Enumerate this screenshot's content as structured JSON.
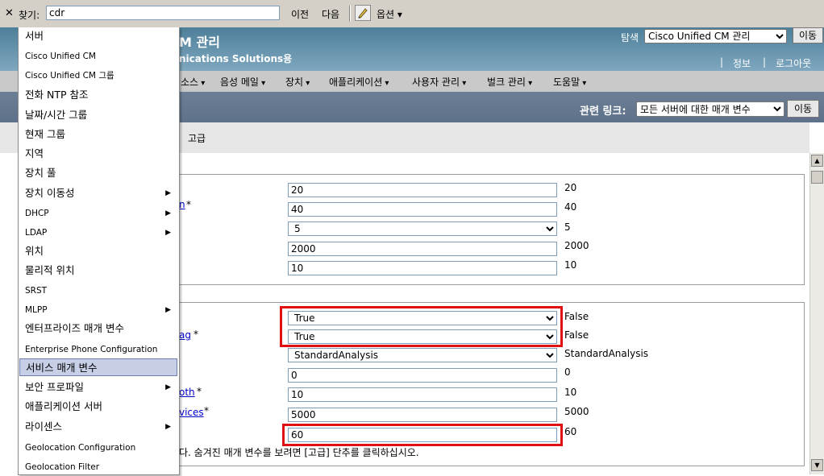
{
  "findbar": {
    "close_glyph": "✕",
    "label": "찾기:",
    "query": "cdr",
    "prev": "이전",
    "next": "다음",
    "options": "옵션"
  },
  "header": {
    "title": "M 관리",
    "subtitle": "nications Solutions용",
    "nav_label": "탐색",
    "nav_value": "Cisco Unified CM 관리",
    "go": "이동",
    "links": [
      "정보",
      "로그아웃"
    ]
  },
  "menubar": [
    "소스",
    "음성 메일",
    "장치",
    "애플리케이션",
    "사용자 관리",
    "벌크 관리",
    "도움말"
  ],
  "related": {
    "label": "관련 링크:",
    "value": "모든 서버에 대한 매개 변수",
    "go": "이동"
  },
  "toolbar": {
    "advanced": "고급"
  },
  "section1": {
    "rows": [
      {
        "value": "20",
        "default": "20",
        "type": "input"
      },
      {
        "label": "n",
        "required": true,
        "value": "40",
        "default": "40",
        "type": "input"
      },
      {
        "value": "5",
        "default": "5",
        "type": "select"
      },
      {
        "value": "2000",
        "default": "2000",
        "type": "input"
      },
      {
        "value": "10",
        "default": "10",
        "type": "input"
      }
    ]
  },
  "section2": {
    "rows": [
      {
        "value": "True",
        "default": "False",
        "type": "select"
      },
      {
        "label": "ag",
        "required": true,
        "value": "True",
        "default": "False",
        "type": "select"
      },
      {
        "value": "StandardAnalysis",
        "default": "StandardAnalysis",
        "type": "select"
      },
      {
        "value": "0",
        "default": "0",
        "type": "input"
      },
      {
        "label": "oth",
        "required": true,
        "value": "10",
        "default": "10",
        "type": "input"
      },
      {
        "label": "vices",
        "required": true,
        "value": "5000",
        "default": "5000",
        "type": "input"
      },
      {
        "value": "60",
        "default": "60",
        "type": "input"
      }
    ]
  },
  "footnote": "다. 숨겨진 매개 변수를 보려면 [고급] 단추를 클릭하십시오.",
  "dropdown": [
    {
      "label": "서버"
    },
    {
      "label": "Cisco Unified CM"
    },
    {
      "label": "Cisco Unified CM 그룹"
    },
    {
      "label": "전화 NTP 참조"
    },
    {
      "label": "날짜/시간 그룹"
    },
    {
      "label": "현재 그룹"
    },
    {
      "label": "지역"
    },
    {
      "label": "장치 풀"
    },
    {
      "label": "장치 이동성",
      "submenu": true
    },
    {
      "label": "DHCP",
      "submenu": true
    },
    {
      "label": "LDAP",
      "submenu": true
    },
    {
      "label": "위치"
    },
    {
      "label": "물리적 위치"
    },
    {
      "label": "SRST"
    },
    {
      "label": "MLPP",
      "submenu": true
    },
    {
      "label": "엔터프라이즈 매개 변수"
    },
    {
      "label": "Enterprise Phone Configuration"
    },
    {
      "label": "서비스 매개 변수",
      "selected": true
    },
    {
      "label": "보안 프로파일",
      "submenu": true
    },
    {
      "label": "애플리케이션 서버"
    },
    {
      "label": "라이센스",
      "submenu": true
    },
    {
      "label": "Geolocation Configuration"
    },
    {
      "label": "Geolocation Filter"
    }
  ],
  "colors": {
    "highlight": "#e01010",
    "header": "#4d7f99",
    "selected_item": "#c7cfe6"
  }
}
